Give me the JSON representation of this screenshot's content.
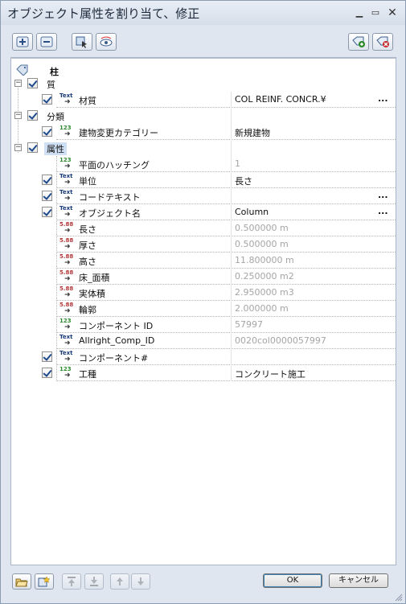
{
  "window": {
    "title": "オブジェクト属性を割り当て、修正",
    "minimize_icon": "minimize-icon",
    "restore_icon": "restore-icon",
    "close_icon": "close-icon"
  },
  "toolbar": {
    "left_buttons": [
      "expand-plus-icon",
      "collapse-minus-icon",
      "select-objects-icon",
      "eye-display-icon"
    ],
    "right_buttons": [
      "add-attribute-icon",
      "remove-attribute-icon"
    ]
  },
  "header": {
    "label": "柱",
    "icon": "tag-icon"
  },
  "groups": {
    "material": {
      "label": "質"
    },
    "category": {
      "label": "分類"
    },
    "attributes": {
      "label": "属性"
    }
  },
  "rows": {
    "material": {
      "name": "材質",
      "value": "COL REINF. CONCR.¥",
      "type": "Text"
    },
    "renovation": {
      "name": "建物変更カテゴリー",
      "value": "新規建物",
      "type": "123"
    },
    "hatching": {
      "name": "平面のハッチング",
      "value": "1",
      "type": "123"
    },
    "unit": {
      "name": "単位",
      "value": "長さ",
      "type": "Text"
    },
    "code_text": {
      "name": "コードテキスト",
      "value": "",
      "type": "Text"
    },
    "object_name": {
      "name": "オブジェクト名",
      "value": "Column",
      "type": "Text"
    },
    "length": {
      "name": "長さ",
      "value": "0.500000 m",
      "type": "5.88"
    },
    "thickness": {
      "name": "厚さ",
      "value": "0.500000 m",
      "type": "5.88"
    },
    "height": {
      "name": "高さ",
      "value": "11.800000 m",
      "type": "5.88"
    },
    "floor_area": {
      "name": "床_面積",
      "value": "0.250000 m2",
      "type": "5.88"
    },
    "volume": {
      "name": "実体積",
      "value": "2.950000 m3",
      "type": "5.88"
    },
    "outline": {
      "name": "輪郭",
      "value": "2.000000 m",
      "type": "5.88"
    },
    "component_id": {
      "name": "コンポーネント ID",
      "value": "57997",
      "type": "123"
    },
    "allright_id": {
      "name": "Allright_Comp_ID",
      "value": "0020col0000057997",
      "type": "Text"
    },
    "component_no": {
      "name": "コンポーネント#",
      "value": "",
      "type": "Text"
    },
    "work_type": {
      "name": "工種",
      "value": "コンクリート施工",
      "type": "123"
    }
  },
  "ellipsis": "...",
  "footer": {
    "ok_label": "OK",
    "cancel_label": "キャンセル"
  },
  "colors": {
    "window_bg": "#dfe6ef",
    "selection_bg": "#cfe0f5",
    "readonly_text": "#a5a5a5"
  }
}
